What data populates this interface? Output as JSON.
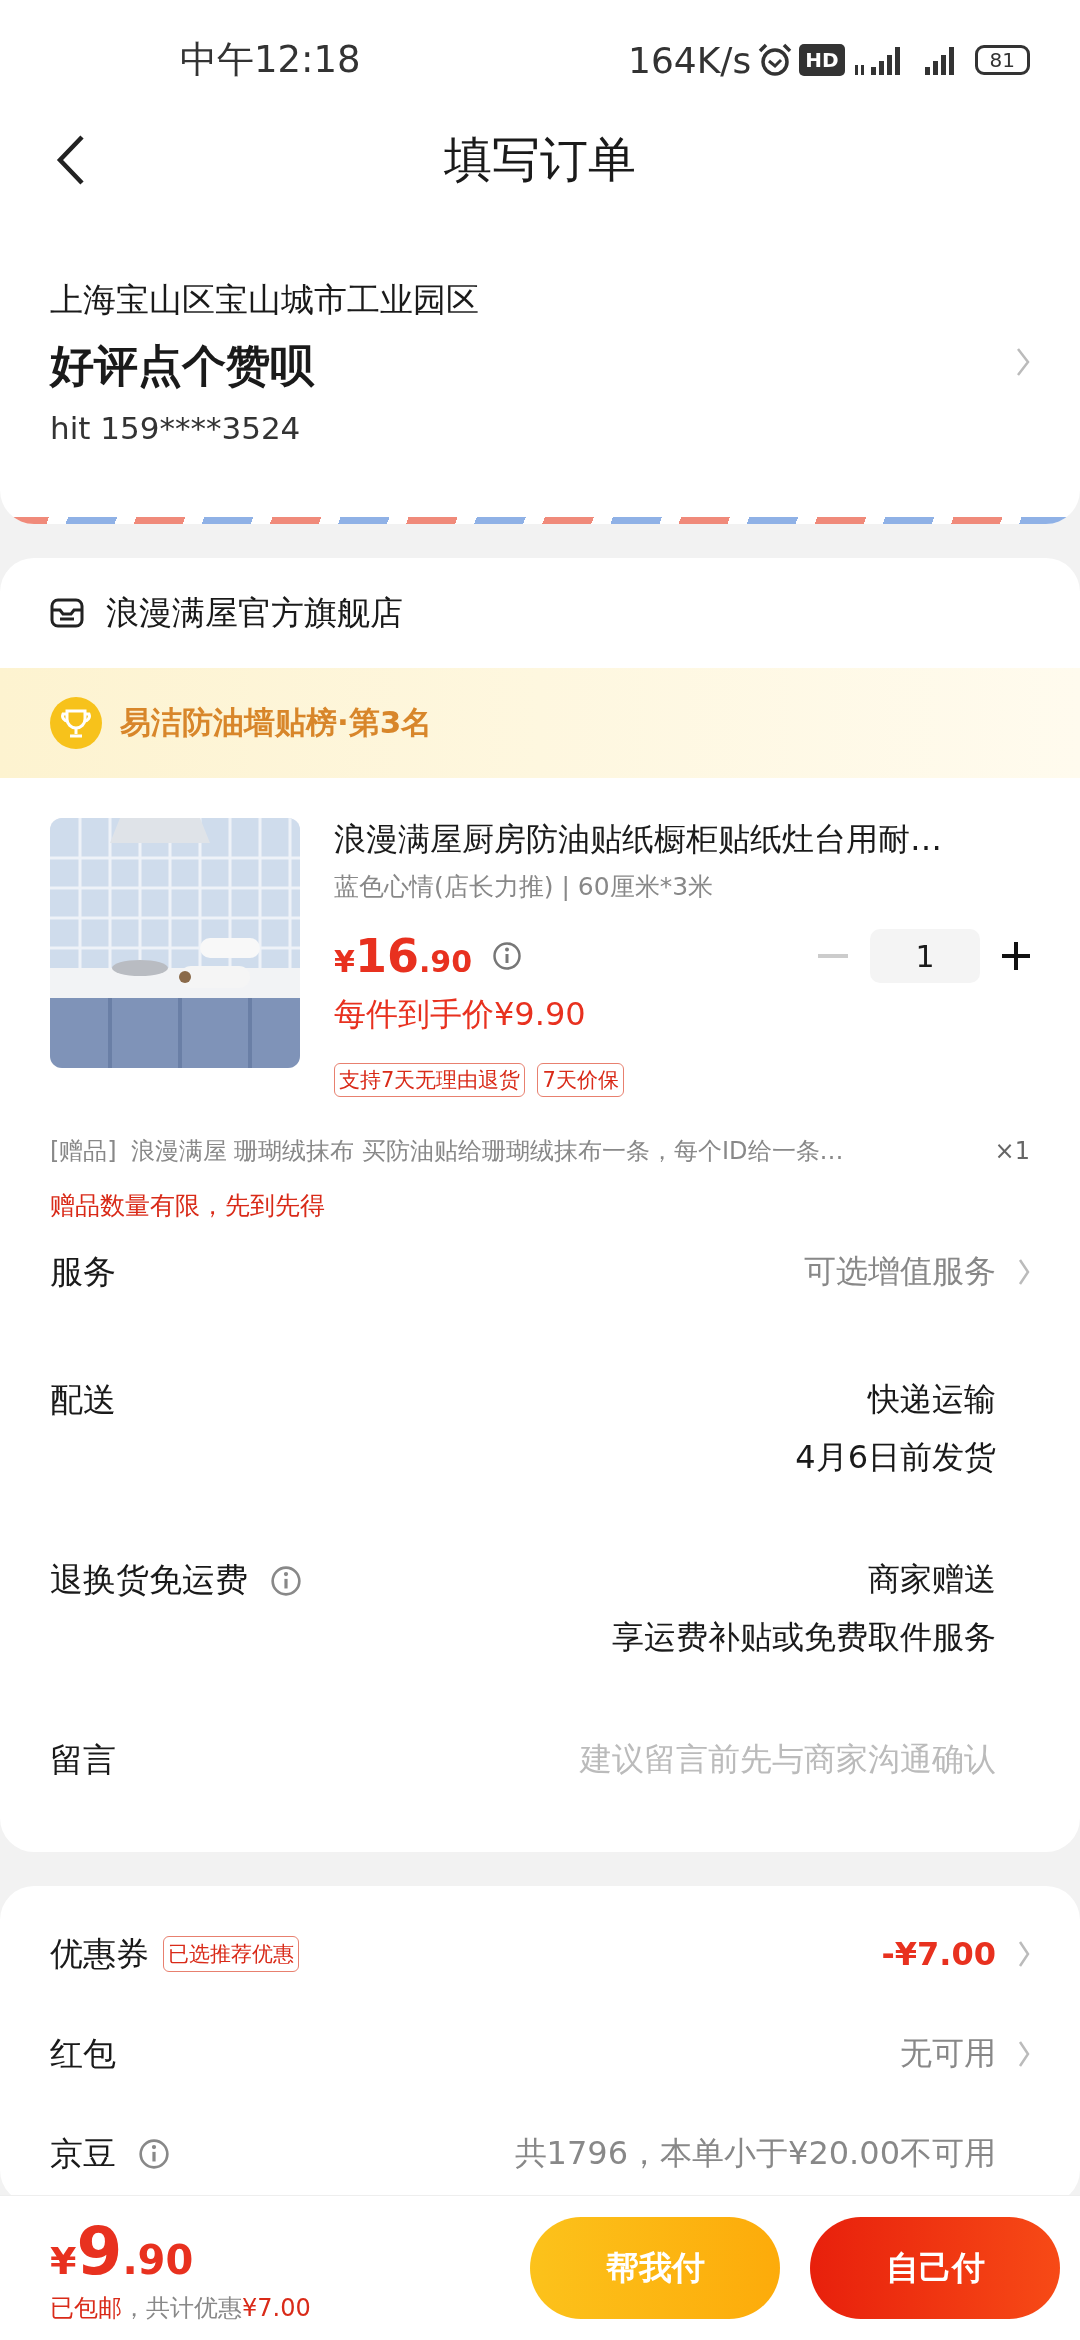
{
  "status_bar": {
    "time": "中午12:18",
    "network_speed": "164K/s",
    "hd": "HD",
    "battery": "81"
  },
  "header": {
    "title": "填写订单"
  },
  "address": {
    "location": "上海宝山区宝山城市工业园区",
    "name": "好评点个赞呗",
    "contact": "hit  159****3524"
  },
  "store": {
    "name": "浪漫满屋官方旗舰店",
    "ranking": "易洁防油墙贴榜·第3名",
    "product": {
      "title": "浪漫满屋厨房防油贴纸橱柜贴纸灶台用耐…",
      "variant": "蓝色心情(店长力推) | 60厘米*3米",
      "price": "¥16.90",
      "unit_price": "每件到手价¥9.90",
      "quantity": "1",
      "tags": [
        "支持7天无理由退货",
        "7天价保"
      ]
    },
    "gift": {
      "label": "[赠品]",
      "text": "浪漫满屋 珊瑚绒抹布 买防油贴给珊瑚绒抹布一条，每个ID给一条…",
      "count": "×1",
      "note": "赠品数量有限，先到先得"
    },
    "rows": [
      {
        "label": "服务",
        "info": false,
        "values": [
          "可选增值服务"
        ],
        "kind": "hint",
        "chevron": true
      },
      {
        "label": "配送",
        "info": false,
        "values": [
          "快递运输",
          "4月6日前发货"
        ],
        "kind": "normal",
        "chevron": false
      },
      {
        "label": "退换货免运费",
        "info": true,
        "values": [
          "商家赠送",
          "享运费补贴或免费取件服务"
        ],
        "kind": "normal",
        "chevron": false
      },
      {
        "label": "留言",
        "info": false,
        "values": [
          "建议留言前先与商家沟通确认"
        ],
        "kind": "placeholder",
        "chevron": false
      }
    ]
  },
  "discounts": [
    {
      "label": "优惠券",
      "info": false,
      "badge": "已选推荐优惠",
      "value": "-¥7.00",
      "kind": "red",
      "chevron": true
    },
    {
      "label": "红包",
      "info": false,
      "value": "无可用",
      "kind": "hint",
      "chevron": true
    },
    {
      "label": "京豆",
      "info": true,
      "value": "共1796，本单小于¥20.00不可用",
      "kind": "hint",
      "chevron": false
    }
  ],
  "bottom_bar": {
    "total": "¥9.90",
    "shipping": "已包邮",
    "savings_label": "，共计优惠",
    "savings": "¥7.00",
    "buttons": [
      {
        "label": "帮我付",
        "kind": "secondary"
      },
      {
        "label": "自己付",
        "kind": "primary"
      }
    ]
  }
}
